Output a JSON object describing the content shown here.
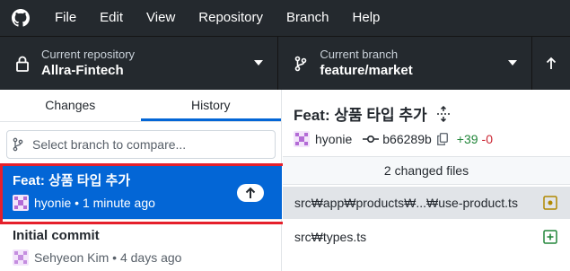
{
  "menu": {
    "items": [
      "File",
      "Edit",
      "View",
      "Repository",
      "Branch",
      "Help"
    ]
  },
  "toolbar": {
    "repo": {
      "sub": "Current repository",
      "name": "Allra-Fintech"
    },
    "branch": {
      "sub": "Current branch",
      "name": "feature/market"
    }
  },
  "left": {
    "tabs": [
      "Changes",
      "History"
    ],
    "active_tab": "History",
    "branch_filter": {
      "placeholder": "Select branch to compare..."
    },
    "commits": [
      {
        "title": "Feat: 상품 타입 추가",
        "author": "hyonie",
        "time": "1 minute ago",
        "selected": true
      },
      {
        "title": "Initial commit",
        "author": "Sehyeon Kim",
        "time": "4 days ago",
        "selected": false
      }
    ]
  },
  "right": {
    "title": "Feat: 상품 타입 추가",
    "author": "hyonie",
    "sha": "b66289b",
    "additions": "+39",
    "deletions": "-0",
    "changed_files_label": "2 changed files",
    "files": [
      {
        "path": "src₩app₩products₩...₩use-product.ts",
        "status": "modified",
        "selected": true
      },
      {
        "path": "src₩types.ts",
        "status": "added",
        "selected": false
      }
    ]
  },
  "colors": {
    "titlebar": "#24292e",
    "accent": "#0366d6",
    "highlight": "#e5202b",
    "added": "#22863a",
    "removed": "#cb2431",
    "modified": "#b08800"
  },
  "icons": {
    "logo": "github-logo-icon",
    "repo": "lock-icon",
    "branch": "git-branch-icon",
    "push": "arrow-up-icon",
    "sha": "git-commit-icon",
    "copy": "copy-icon",
    "expand": "expand-icon",
    "modified": "file-modified-icon",
    "added": "file-added-icon"
  }
}
